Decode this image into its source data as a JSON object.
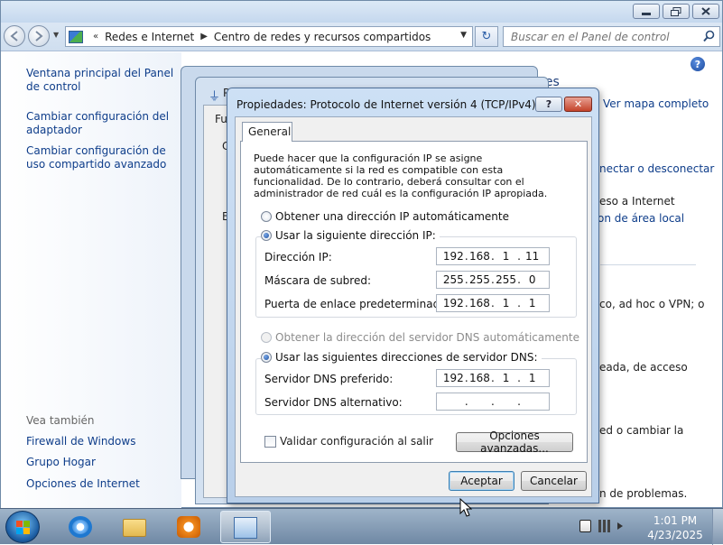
{
  "breadcrumb": {
    "items": [
      "Redes e Internet",
      "Centro de redes y recursos compartidos"
    ]
  },
  "search": {
    "placeholder": "Buscar en el Panel de control"
  },
  "left_panel": {
    "links": [
      "Ventana principal del Panel de control",
      "Cambiar configuración del adaptador",
      "Cambiar configuración de uso compartido avanzado"
    ],
    "see_also_title": "Vea también",
    "see_also": [
      "Firewall de Windows",
      "Grupo Hogar",
      "Opciones de Internet"
    ]
  },
  "right_panel": {
    "fragments": [
      "nes",
      "Ver mapa completo",
      "nectar o desconectar",
      "eso a Internet",
      "on de área local",
      "co, ad hoc o VPN; o",
      "eada, de acceso",
      "ed o cambiar la",
      "n de problemas."
    ]
  },
  "background_dialogs": {
    "fragments": [
      "P",
      "Fu",
      "C",
      "E"
    ]
  },
  "dialog": {
    "title": "Propiedades: Protocolo de Internet versión 4 (TCP/IPv4)",
    "help_label": "?",
    "close_label": "✕",
    "tab": "General",
    "intro": "Puede hacer que la configuración IP se asigne automáticamente si la red es compatible con esta funcionalidad. De lo contrario, deberá consultar con el administrador de red cuál es la configuración IP apropiada.",
    "ip_auto_label": "Obtener una dirección IP automáticamente",
    "ip_manual_label": "Usar la siguiente dirección IP:",
    "ip_label": "Dirección IP:",
    "ip": [
      "192",
      "168",
      "1",
      "11"
    ],
    "mask_label": "Máscara de subred:",
    "mask": [
      "255",
      "255",
      "255",
      "0"
    ],
    "gateway_label": "Puerta de enlace predeterminada:",
    "gateway": [
      "192",
      "168",
      "1",
      "1"
    ],
    "dns_auto_label": "Obtener la dirección del servidor DNS automáticamente",
    "dns_manual_label": "Usar las siguientes direcciones de servidor DNS:",
    "dns_pref_label": "Servidor DNS preferido:",
    "dns_pref": [
      "192",
      "168",
      "1",
      "1"
    ],
    "dns_alt_label": "Servidor DNS alternativo:",
    "dns_alt": [
      "",
      "",
      "",
      ""
    ],
    "validate_label": "Validar configuración al salir",
    "advanced_label": "Opciones avanzadas...",
    "ok_label": "Aceptar",
    "cancel_label": "Cancelar"
  },
  "taskbar": {
    "clock_time": "1:01 PM",
    "clock_date": "4/23/2025"
  },
  "icons": {
    "window_controls": [
      "minimize-icon",
      "maximize-icon",
      "close-icon"
    ],
    "taskbar_apps": [
      "internet-explorer-icon",
      "explorer-folder-icon",
      "media-player-icon",
      "network-center-icon"
    ],
    "tray": [
      "battery-icon",
      "network-icon",
      "volume-icon"
    ]
  },
  "colors": {
    "link": "#0e3d8a",
    "accent": "#1d4f9c"
  }
}
